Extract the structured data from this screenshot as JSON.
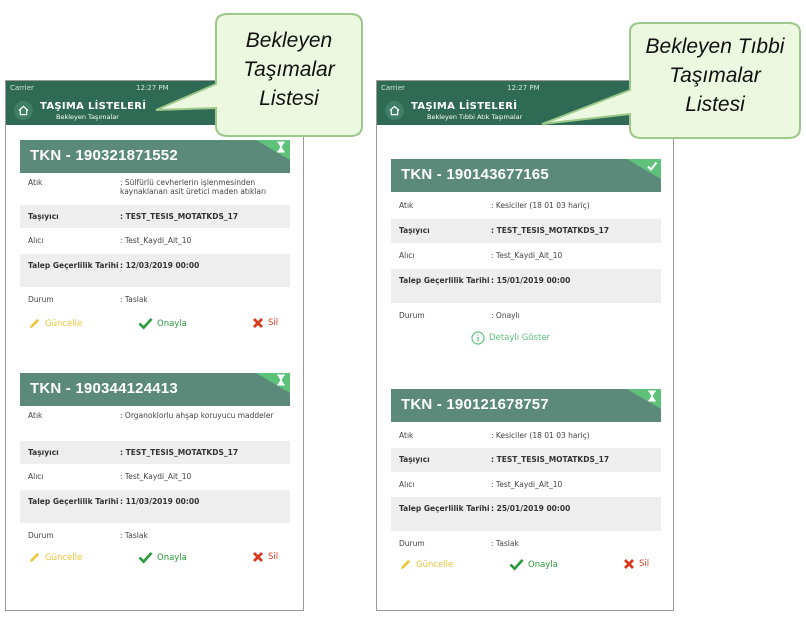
{
  "left": {
    "status": {
      "carrier": "Carrier",
      "time": "12:27 PM"
    },
    "header": {
      "title": "TAŞIMA LİSTELERİ",
      "subtitle": "Bekleyen Taşımalar"
    },
    "callout": {
      "lines": [
        "Bekleyen",
        "Taşımalar",
        "Listesi"
      ]
    },
    "cards": [
      {
        "tkn": "TKN - 190321871552",
        "status_icon": "hourglass-icon",
        "rows": [
          {
            "label": "Atık",
            "value": ": Sülfürlü cevherlerin işlenmesinden kaynaklanan asit üretici maden atıkları"
          },
          {
            "label": "Taşıyıcı",
            "value": ": TEST_TESIS_MOTATKDS_17"
          },
          {
            "label": "Alıcı",
            "value": ": Test_Kaydi_Ait_10"
          },
          {
            "label": "Talep Geçerlilik Tarihi",
            "value": ": 12/03/2019 00:00"
          },
          {
            "label": "Durum",
            "value": ": Taslak"
          }
        ],
        "actions": {
          "update": "Güncelle",
          "approve": "Onayla",
          "delete": "Sil"
        }
      },
      {
        "tkn": "TKN - 190344124413",
        "status_icon": "hourglass-icon",
        "rows": [
          {
            "label": "Atık",
            "value": ": Organoklorlu ahşap koruyucu maddeler"
          },
          {
            "label": "Taşıyıcı",
            "value": ": TEST_TESIS_MOTATKDS_17"
          },
          {
            "label": "Alıcı",
            "value": ": Test_Kaydi_Ait_10"
          },
          {
            "label": "Talep Geçerlilik Tarihi",
            "value": ": 11/03/2019 00:00"
          },
          {
            "label": "Durum",
            "value": ": Taslak"
          }
        ],
        "actions": {
          "update": "Güncelle",
          "approve": "Onayla",
          "delete": "Sil"
        }
      }
    ]
  },
  "right": {
    "status": {
      "carrier": "Carrier",
      "time": "12:27 PM"
    },
    "header": {
      "title": "TAŞIMA LİSTELERİ",
      "subtitle": "Bekleyen Tıbbi Atık Taşımalar"
    },
    "callout": {
      "lines": [
        "Bekleyen Tıbbi",
        "Taşımalar",
        "Listesi"
      ]
    },
    "cards": [
      {
        "tkn": "TKN - 190143677165",
        "status_icon": "check-icon",
        "rows": [
          {
            "label": "Atık",
            "value": ": Kesiciler (18 01 03 hariç)"
          },
          {
            "label": "Taşıyıcı",
            "value": ": TEST_TESIS_MOTATKDS_17"
          },
          {
            "label": "Alıcı",
            "value": ": Test_Kaydi_Ait_10"
          },
          {
            "label": "Talep Geçerlilik Tarihi",
            "value": ": 15/01/2019 00:00"
          },
          {
            "label": "Durum",
            "value": ": Onaylı"
          }
        ],
        "detail": "Detaylı Göster"
      },
      {
        "tkn": "TKN - 190121678757",
        "status_icon": "hourglass-icon",
        "rows": [
          {
            "label": "Atık",
            "value": ": Kesiciler (18 01 03 hariç)"
          },
          {
            "label": "Taşıyıcı",
            "value": ": TEST_TESIS_MOTATKDS_17"
          },
          {
            "label": "Alıcı",
            "value": ": Test_Kaydi_Ait_10"
          },
          {
            "label": "Talep Geçerlilik Tarihi",
            "value": ": 25/01/2019 00:00"
          },
          {
            "label": "Durum",
            "value": ": Taslak"
          }
        ],
        "actions": {
          "update": "Güncelle",
          "approve": "Onayla",
          "delete": "Sil"
        }
      }
    ]
  },
  "colors": {
    "header": "#2f6b54",
    "card_header": "#5b8a7b",
    "status_corner": "#5fc27a",
    "update": "#e9c63a",
    "approve": "#2a9a3a",
    "delete": "#d63b1f",
    "callout_fill": "#ecf8df"
  }
}
